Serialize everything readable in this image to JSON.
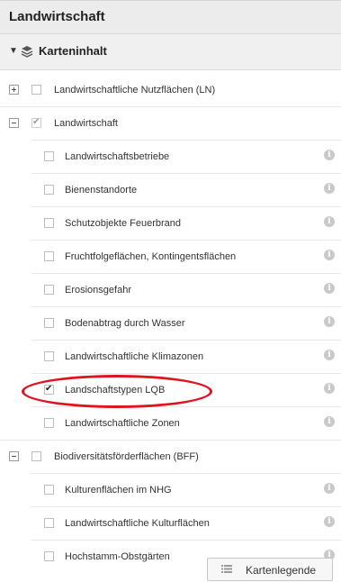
{
  "header": {
    "title": "Landwirtschaft"
  },
  "section": {
    "label": "Karteninhalt",
    "icon": "layers-icon"
  },
  "rows": [
    {
      "label": "Landwirtschaftliche Nutzflächen (LN)",
      "expander": "plus",
      "checked": false
    },
    {
      "label": "Landwirtschaft",
      "expander": "minus",
      "checked": true,
      "disabled": true
    },
    {
      "label": "Landwirtschaftsbetriebe",
      "checked": false,
      "info": true
    },
    {
      "label": "Bienenstandorte",
      "checked": false,
      "info": true
    },
    {
      "label": "Schutzobjekte Feuerbrand",
      "checked": false,
      "info": true
    },
    {
      "label": "Fruchtfolgeflächen, Kontingentsflächen",
      "checked": false,
      "info": true
    },
    {
      "label": "Erosionsgefahr",
      "checked": false,
      "info": true
    },
    {
      "label": "Bodenabtrag durch Wasser",
      "checked": false,
      "info": true
    },
    {
      "label": "Landwirtschaftliche Klimazonen",
      "checked": false,
      "info": true
    },
    {
      "label": "Landschaftstypen LQB",
      "checked": true,
      "info": true,
      "highlighted": true
    },
    {
      "label": "Landwirtschaftliche Zonen",
      "checked": false,
      "info": true
    },
    {
      "label": "Biodiversitätsförderflächen (BFF)",
      "expander": "minus",
      "checked": false
    },
    {
      "label": "Kulturenflächen im NHG",
      "checked": false,
      "info": true
    },
    {
      "label": "Landwirtschaftliche Kulturflächen",
      "checked": false,
      "info": true
    },
    {
      "label": "Hochstamm-Obstgärten",
      "checked": false,
      "info": true
    }
  ],
  "info_glyph": "i",
  "legend_button": {
    "label": "Kartenlegende",
    "icon": "list-icon"
  },
  "colors": {
    "highlight": "#e0141e",
    "header_bg": "#ececec"
  }
}
